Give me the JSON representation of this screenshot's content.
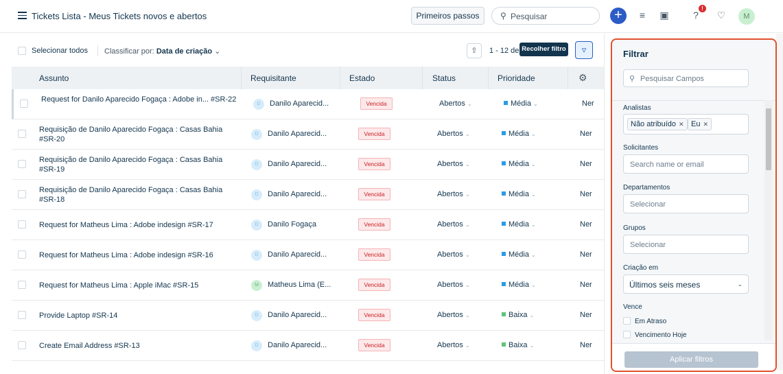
{
  "header": {
    "title": "Tickets Lista  -  Meus Tickets novos e abertos",
    "primeiros_passos": "Primeiros passos",
    "search_placeholder": "Pesquisar",
    "avatar_initial": "M",
    "notification_badge": "!"
  },
  "toolbar": {
    "select_all": "Selecionar todos",
    "sort_prefix": "Classificar por:",
    "sort_value": "Data de criação",
    "pagination": "1 - 12 de",
    "tooltip": "Recolher filtro"
  },
  "table": {
    "columns": [
      "Assunto",
      "Requisitante",
      "Estado",
      "Status",
      "Prioridade"
    ],
    "rows": [
      {
        "subject": "Request for Danilo Aparecido Fogaça : Adobe in...  #SR-22",
        "avatar": "D",
        "requester": "Danilo Aparecid...",
        "state": "Vencida",
        "status": "Abertos",
        "priority": "Média",
        "priority_color": "#2c9be6",
        "extra": "Ner"
      },
      {
        "subject": "Requisição de Danilo Aparecido Fogaça : Casas Bahia  #SR-20",
        "avatar": "D",
        "requester": "Danilo Aparecid...",
        "state": "Vencida",
        "status": "Abertos",
        "priority": "Média",
        "priority_color": "#2c9be6",
        "extra": "Ner"
      },
      {
        "subject": "Requisição de Danilo Aparecido Fogaça : Casas Bahia  #SR-19",
        "avatar": "D",
        "requester": "Danilo Aparecid...",
        "state": "Vencida",
        "status": "Abertos",
        "priority": "Média",
        "priority_color": "#2c9be6",
        "extra": "Ner"
      },
      {
        "subject": "Requisição de Danilo Aparecido Fogaça : Casas Bahia  #SR-18",
        "avatar": "D",
        "requester": "Danilo Aparecid...",
        "state": "Vencida",
        "status": "Abertos",
        "priority": "Média",
        "priority_color": "#2c9be6",
        "extra": "Ner"
      },
      {
        "subject": "Request for Matheus Lima : Adobe indesign  #SR-17",
        "avatar": "D",
        "requester": "Danilo Fogaça",
        "state": "Vencida",
        "status": "Abertos",
        "priority": "Média",
        "priority_color": "#2c9be6",
        "extra": "Ner"
      },
      {
        "subject": "Request for Matheus Lima : Adobe indesign  #SR-16",
        "avatar": "D",
        "requester": "Danilo Aparecid...",
        "state": "Vencida",
        "status": "Abertos",
        "priority": "Média",
        "priority_color": "#2c9be6",
        "extra": "Ner"
      },
      {
        "subject": "Request for Matheus Lima : Apple iMac  #SR-15",
        "avatar": "M",
        "requester": "Matheus Lima (E...",
        "state": "Vencida",
        "status": "Abertos",
        "priority": "Média",
        "priority_color": "#2c9be6",
        "extra": "Ner"
      },
      {
        "subject": "Provide Laptop  #SR-14",
        "avatar": "D",
        "requester": "Danilo Aparecid...",
        "state": "Vencida",
        "status": "Abertos",
        "priority": "Baixa",
        "priority_color": "#5fc37a",
        "extra": "Ner"
      },
      {
        "subject": "Create Email Address  #SR-13",
        "avatar": "D",
        "requester": "Danilo Aparecid...",
        "state": "Vencida",
        "status": "Abertos",
        "priority": "Baixa",
        "priority_color": "#5fc37a",
        "extra": "Ner"
      }
    ]
  },
  "filter": {
    "title": "Filtrar",
    "search_placeholder": "Pesquisar Campos",
    "analistas_label": "Analistas",
    "tag_1": "Não atribuído",
    "tag_2": "Eu",
    "solicitantes_label": "Solicitantes",
    "solicitantes_placeholder": "Search name or email",
    "departamentos_label": "Departamentos",
    "departamentos_placeholder": "Selecionar",
    "grupos_label": "Grupos",
    "grupos_placeholder": "Selecionar",
    "criacao_label": "Criação em",
    "criacao_value": "Últimos seis meses",
    "vence_label": "Vence",
    "option_1": "Em Atraso",
    "option_2": "Vencimento Hoje",
    "apply": "Aplicar filtros"
  },
  "icons": [
    "menu-icon",
    "search-icon",
    "plus-icon",
    "checklist-icon",
    "calendar-icon",
    "help-icon",
    "bell-icon",
    "filter-icon",
    "gear-icon",
    "chevron-down-icon",
    "arrow-up-icon"
  ],
  "colors": {
    "accent": "#2c5cc5",
    "overdue": "#c82124",
    "highlight_border": "#e0512e"
  }
}
